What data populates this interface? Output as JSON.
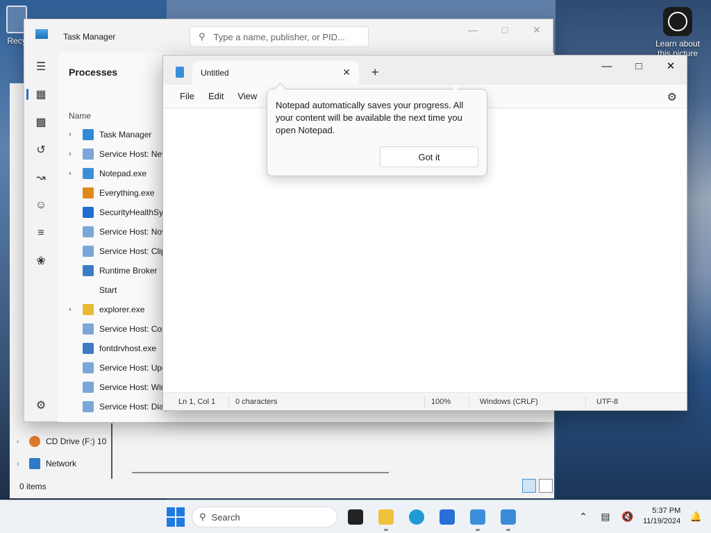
{
  "desktop": {
    "recycle_label": "Recy",
    "learn_label": "Learn about this picture"
  },
  "explorer": {
    "nav": [
      {
        "label": "CD Drive (F:) 10",
        "icon": "cd-drive-icon"
      },
      {
        "label": "Network",
        "icon": "network-icon"
      }
    ],
    "status": "0 items"
  },
  "task_manager": {
    "title": "Task Manager",
    "search_placeholder": "Type a name, publisher, or PID...",
    "page_title": "Processes",
    "column_name": "Name",
    "processes": [
      {
        "name": "Task Manager",
        "expandable": true,
        "icon": "task-manager-icon",
        "color": "#2f8ad8"
      },
      {
        "name": "Service Host: Netw",
        "expandable": true,
        "icon": "gear-icon",
        "color": "#7aa7d8"
      },
      {
        "name": "Notepad.exe",
        "expandable": true,
        "icon": "notepad-icon",
        "color": "#3b8fd9"
      },
      {
        "name": "Everything.exe",
        "expandable": false,
        "icon": "magnifier-icon",
        "color": "#e08a1e"
      },
      {
        "name": "SecurityHealthSys",
        "expandable": false,
        "icon": "shield-icon",
        "color": "#1f6fd1"
      },
      {
        "name": "Service Host: Now",
        "expandable": false,
        "icon": "gear-icon",
        "color": "#7aa7d8"
      },
      {
        "name": "Service Host: Clip",
        "expandable": false,
        "icon": "gear-icon",
        "color": "#7aa7d8"
      },
      {
        "name": "Runtime Broker",
        "expandable": false,
        "icon": "window-icon",
        "color": "#3d7bc4"
      },
      {
        "name": "Start",
        "expandable": false,
        "icon": "",
        "color": ""
      },
      {
        "name": "explorer.exe",
        "expandable": true,
        "icon": "folder-icon",
        "color": "#e9b934"
      },
      {
        "name": "Service Host: Con",
        "expandable": false,
        "icon": "gear-icon",
        "color": "#7aa7d8"
      },
      {
        "name": "fontdrvhost.exe",
        "expandable": false,
        "icon": "window-icon",
        "color": "#3d7bc4"
      },
      {
        "name": "Service Host: Upd",
        "expandable": false,
        "icon": "gear-icon",
        "color": "#7aa7d8"
      },
      {
        "name": "Service Host: Win",
        "expandable": false,
        "icon": "gear-icon",
        "color": "#7aa7d8"
      },
      {
        "name": "Service Host: Diag",
        "expandable": false,
        "icon": "gear-icon",
        "color": "#7aa7d8"
      }
    ]
  },
  "notepad": {
    "tab_title": "Untitled",
    "menu": [
      "File",
      "Edit",
      "View"
    ],
    "tip_message": "Notepad automatically saves your progress. All your content will be available the next time you open Notepad.",
    "tip_button": "Got it",
    "status": {
      "position": "Ln 1, Col 1",
      "characters": "0 characters",
      "zoom": "100%",
      "line_ending": "Windows (CRLF)",
      "encoding": "UTF-8"
    }
  },
  "taskbar": {
    "search_label": "Search",
    "time": "5:37 PM",
    "date": "11/19/2024"
  }
}
